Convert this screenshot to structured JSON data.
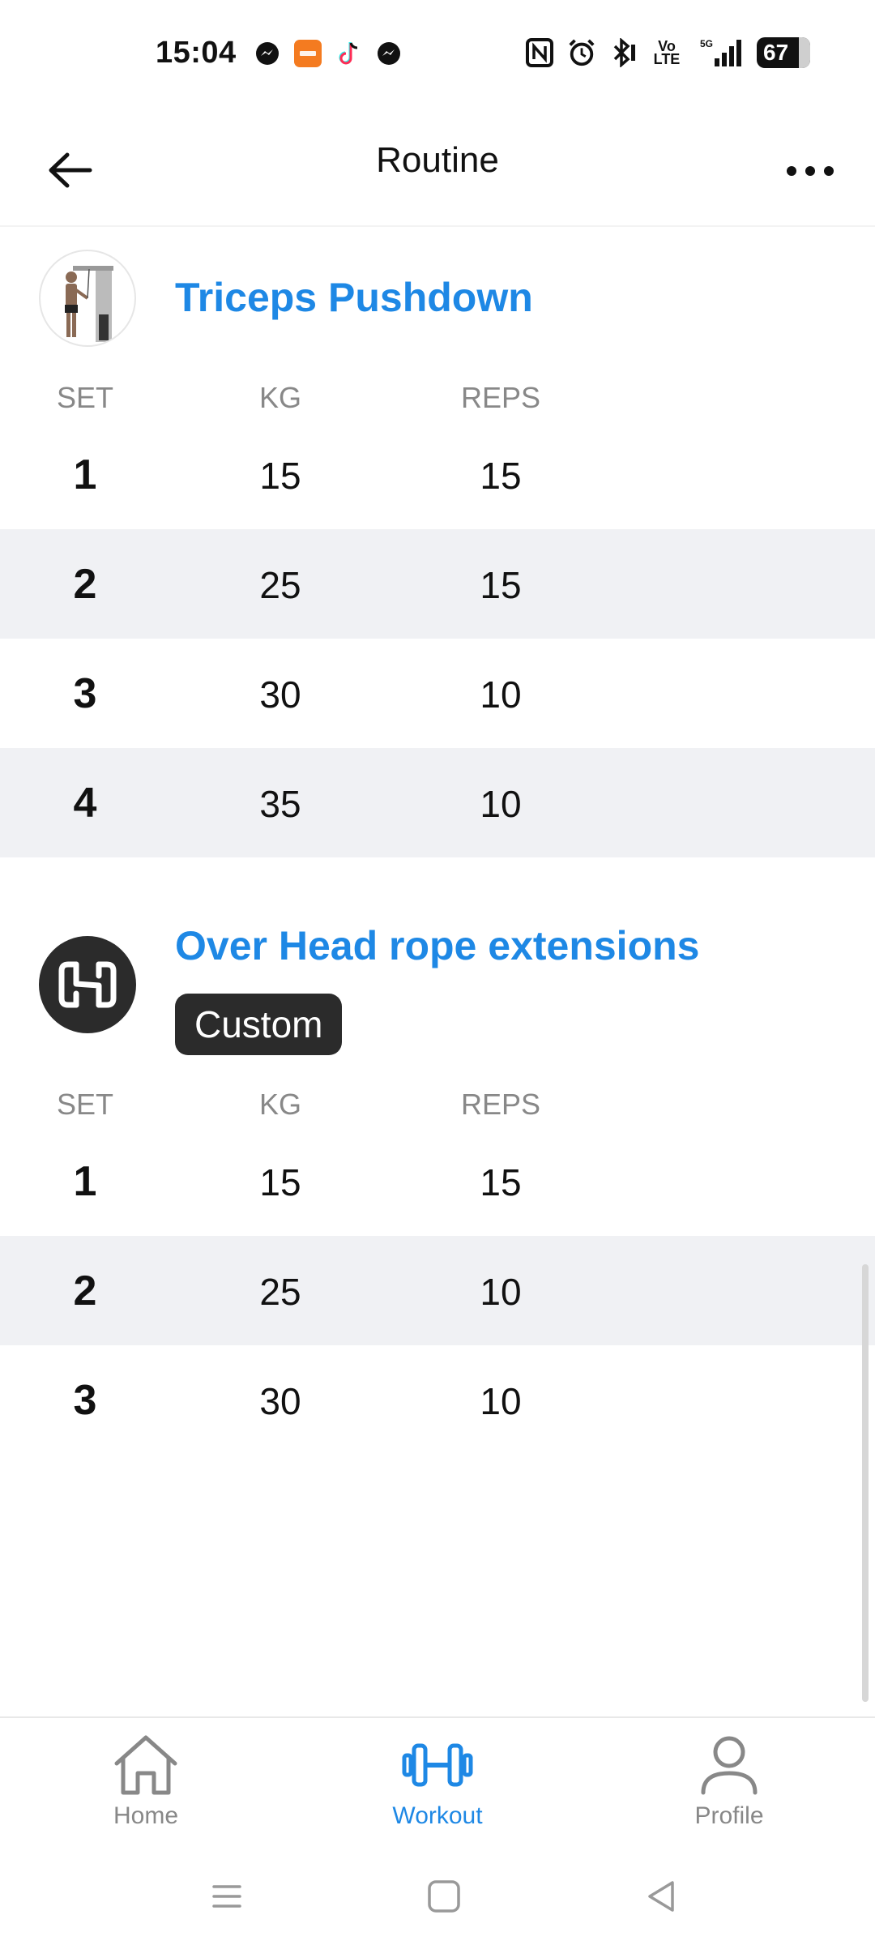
{
  "status_bar": {
    "time": "15:04",
    "left_icons": [
      "messenger-icon",
      "temu-icon",
      "tiktok-icon",
      "messenger-icon"
    ],
    "right_icons": [
      "nfc-icon",
      "alarm-icon",
      "bluetooth-icon",
      "volte-icon",
      "5g-signal-icon"
    ],
    "battery": "67",
    "volte_label": "Vo LTE",
    "network_label": "5G"
  },
  "header": {
    "title": "Routine"
  },
  "columns": {
    "set": "SET",
    "kg": "KG",
    "reps": "REPS"
  },
  "exercises": [
    {
      "name": "Triceps Pushdown",
      "sets": [
        {
          "set": "1",
          "kg": "15",
          "reps": "15"
        },
        {
          "set": "2",
          "kg": "25",
          "reps": "15"
        },
        {
          "set": "3",
          "kg": "30",
          "reps": "10"
        },
        {
          "set": "4",
          "kg": "35",
          "reps": "10"
        }
      ]
    },
    {
      "name": "Over Head rope extensions",
      "badge": "Custom",
      "sets": [
        {
          "set": "1",
          "kg": "15",
          "reps": "15"
        },
        {
          "set": "2",
          "kg": "25",
          "reps": "10"
        },
        {
          "set": "3",
          "kg": "30",
          "reps": "10"
        }
      ]
    }
  ],
  "bottom_nav": {
    "items": [
      {
        "label": "Home",
        "icon": "home-icon",
        "active": false
      },
      {
        "label": "Workout",
        "icon": "dumbbell-icon",
        "active": true
      },
      {
        "label": "Profile",
        "icon": "profile-icon",
        "active": false
      }
    ]
  },
  "colors": {
    "accent": "#1e88e5",
    "alt_row": "#f0f1f4",
    "badge_bg": "#2b2b2b",
    "muted": "#888888"
  }
}
